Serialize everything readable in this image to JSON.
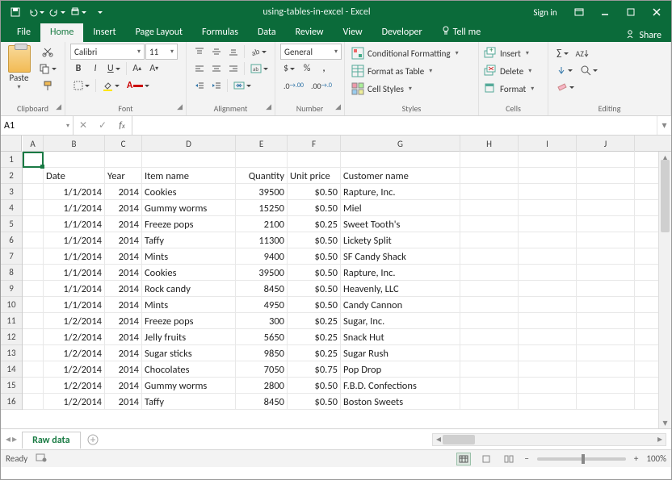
{
  "title": "using-tables-in-excel - Excel",
  "signin": "Sign in",
  "tabs": {
    "file": "File",
    "home": "Home",
    "insert": "Insert",
    "pagelayout": "Page Layout",
    "formulas": "Formulas",
    "data": "Data",
    "review": "Review",
    "view": "View",
    "developer": "Developer",
    "tellme": "Tell me"
  },
  "share": "Share",
  "ribbon": {
    "clipboard": {
      "title": "Clipboard",
      "paste": "Paste"
    },
    "font": {
      "title": "Font",
      "name": "Calibri",
      "size": "11"
    },
    "alignment": {
      "title": "Alignment"
    },
    "number": {
      "title": "Number",
      "format": "General"
    },
    "styles": {
      "title": "Styles",
      "cond": "Conditional Formatting",
      "table": "Format as Table",
      "cell": "Cell Styles"
    },
    "cells": {
      "title": "Cells",
      "insert": "Insert",
      "delete": "Delete",
      "format": "Format"
    },
    "editing": {
      "title": "Editing"
    }
  },
  "namebox": "A1",
  "columns": [
    "A",
    "B",
    "C",
    "D",
    "E",
    "F",
    "G",
    "H",
    "I",
    "J"
  ],
  "rownums": [
    "1",
    "2",
    "3",
    "4",
    "5",
    "6",
    "7",
    "8",
    "9",
    "10",
    "11",
    "12",
    "13",
    "14",
    "15",
    "16"
  ],
  "headers": {
    "date": "Date",
    "year": "Year",
    "item": "Item name",
    "qty": "Quantity",
    "price": "Unit price",
    "cust": "Customer name"
  },
  "rows": [
    {
      "date": "1/1/2014",
      "year": "2014",
      "item": "Cookies",
      "qty": "39500",
      "price": "$0.50",
      "cust": "Rapture, Inc."
    },
    {
      "date": "1/1/2014",
      "year": "2014",
      "item": "Gummy worms",
      "qty": "15250",
      "price": "$0.50",
      "cust": "Miel"
    },
    {
      "date": "1/1/2014",
      "year": "2014",
      "item": "Freeze pops",
      "qty": "2100",
      "price": "$0.25",
      "cust": "Sweet Tooth's"
    },
    {
      "date": "1/1/2014",
      "year": "2014",
      "item": "Taffy",
      "qty": "11300",
      "price": "$0.50",
      "cust": "Lickety Split"
    },
    {
      "date": "1/1/2014",
      "year": "2014",
      "item": "Mints",
      "qty": "9400",
      "price": "$0.50",
      "cust": "SF Candy Shack"
    },
    {
      "date": "1/1/2014",
      "year": "2014",
      "item": "Cookies",
      "qty": "39500",
      "price": "$0.50",
      "cust": "Rapture, Inc."
    },
    {
      "date": "1/1/2014",
      "year": "2014",
      "item": "Rock candy",
      "qty": "8450",
      "price": "$0.50",
      "cust": "Heavenly, LLC"
    },
    {
      "date": "1/1/2014",
      "year": "2014",
      "item": "Mints",
      "qty": "4950",
      "price": "$0.50",
      "cust": "Candy Cannon"
    },
    {
      "date": "1/2/2014",
      "year": "2014",
      "item": "Freeze pops",
      "qty": "300",
      "price": "$0.25",
      "cust": "Sugar, Inc."
    },
    {
      "date": "1/2/2014",
      "year": "2014",
      "item": "Jelly fruits",
      "qty": "5650",
      "price": "$0.25",
      "cust": "Snack Hut"
    },
    {
      "date": "1/2/2014",
      "year": "2014",
      "item": "Sugar sticks",
      "qty": "9850",
      "price": "$0.25",
      "cust": "Sugar Rush"
    },
    {
      "date": "1/2/2014",
      "year": "2014",
      "item": "Chocolates",
      "qty": "7050",
      "price": "$0.75",
      "cust": "Pop Drop"
    },
    {
      "date": "1/2/2014",
      "year": "2014",
      "item": "Gummy worms",
      "qty": "2800",
      "price": "$0.50",
      "cust": "F.B.D. Confections"
    },
    {
      "date": "1/2/2014",
      "year": "2014",
      "item": "Taffy",
      "qty": "8450",
      "price": "$0.50",
      "cust": "Boston Sweets"
    }
  ],
  "sheet_tab": "Raw data",
  "status": "Ready",
  "zoom": "100%"
}
